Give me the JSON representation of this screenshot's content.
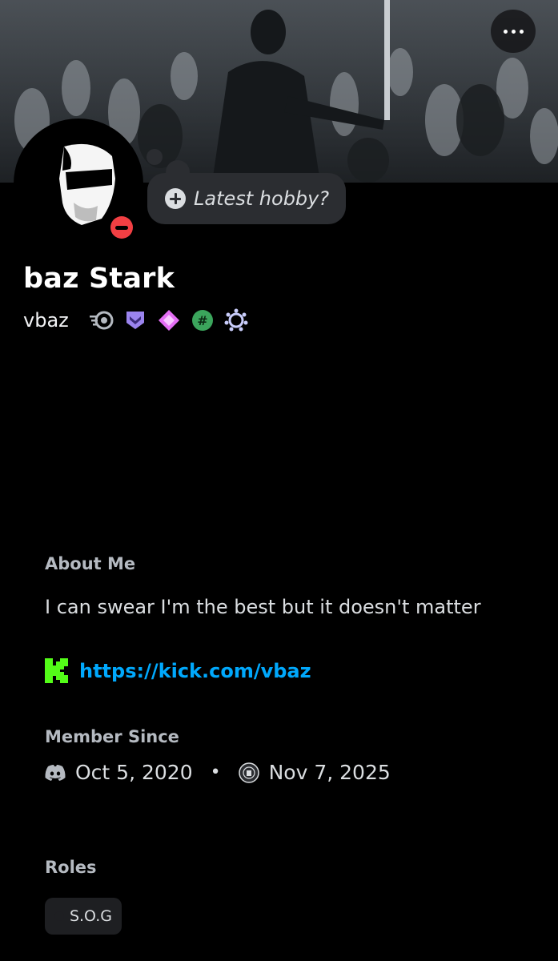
{
  "header": {
    "more_button_icon": "more-horizontal-icon"
  },
  "status_prompt": {
    "icon": "plus-circle-icon",
    "text": "Latest hobby?"
  },
  "profile": {
    "display_name": "baz Stark",
    "username": "vbaz",
    "status": "do-not-disturb",
    "status_color": "#f23f43",
    "badges": [
      "speed-badge-icon",
      "hypesquad-badge-icon",
      "nitro-gem-badge-icon",
      "hashtag-badge-icon",
      "quest-laurel-badge-icon"
    ]
  },
  "about": {
    "label": "About Me",
    "bio": "I can swear I'm the best but it doesn't matter",
    "link_icon": "kick-logo-icon",
    "link": "https://kick.com/vbaz"
  },
  "member_since": {
    "label": "Member Since",
    "discord_icon": "discord-icon",
    "discord_date": "Oct 5, 2020",
    "separator": "•",
    "server_icon": "server-icon",
    "server_date": "Nov 7, 2025"
  },
  "roles": {
    "label": "Roles",
    "items": [
      {
        "name": "S.O.G"
      }
    ]
  },
  "colors": {
    "background": "#000000",
    "link": "#00a8fc",
    "kick_green": "#53fc18",
    "label_gray": "#b5bac1"
  }
}
